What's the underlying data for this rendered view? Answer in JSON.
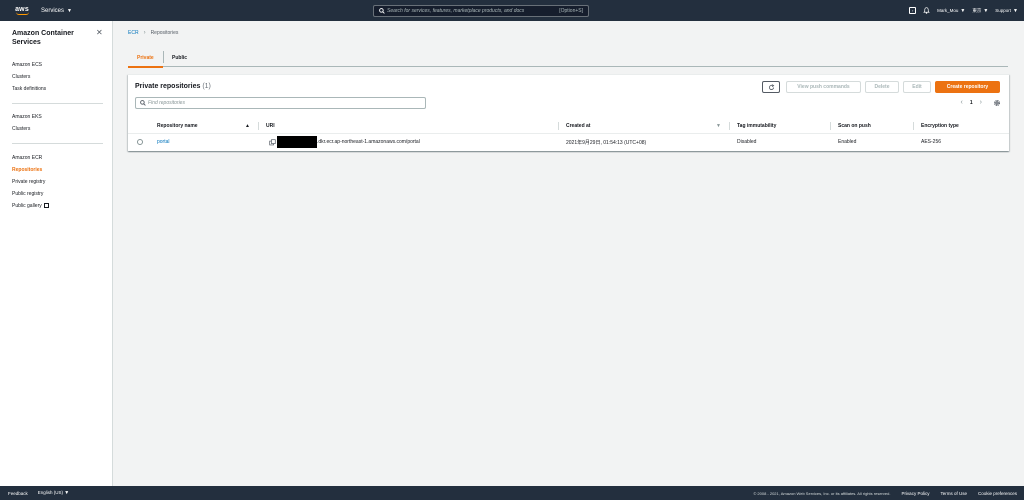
{
  "topnav": {
    "logo": "aws",
    "services_label": "Services",
    "search_placeholder": "Search for services, features, marketplace products, and docs",
    "search_shortcut": "[Option+S]",
    "user": "Mark_Mou",
    "region": "東京",
    "support": "Support"
  },
  "sidebar": {
    "title": "Amazon Container Services",
    "groups": [
      {
        "items": [
          {
            "label": "Amazon ECS"
          },
          {
            "label": "Clusters"
          },
          {
            "label": "Task definitions"
          }
        ]
      },
      {
        "items": [
          {
            "label": "Amazon EKS"
          },
          {
            "label": "Clusters"
          }
        ]
      },
      {
        "items": [
          {
            "label": "Amazon ECR"
          },
          {
            "label": "Repositories",
            "active": true
          },
          {
            "label": "Private registry"
          },
          {
            "label": "Public registry"
          },
          {
            "label": "Public gallery"
          }
        ]
      }
    ]
  },
  "breadcrumb": {
    "root": "ECR",
    "current": "Repositories"
  },
  "tabs": [
    {
      "label": "Private",
      "active": true
    },
    {
      "label": "Public"
    }
  ],
  "panel": {
    "title": "Private repositories",
    "count": "(1)",
    "buttons": {
      "view_push": "View push commands",
      "delete": "Delete",
      "edit": "Edit",
      "create": "Create repository"
    },
    "find_placeholder": "Find repositories",
    "page": "1"
  },
  "table": {
    "columns": [
      "Repository name",
      "URI",
      "Created at",
      "Tag immutability",
      "Scan on push",
      "Encryption type"
    ],
    "rows": [
      {
        "name": "portal",
        "uri": ".dkr.ecr.ap-northeast-1.amazonaws.com/portal",
        "created_at": "2021年9月29日, 01:54:13 (UTC+08)",
        "tag_immutability": "Disabled",
        "scan_on_push": "Enabled",
        "encryption": "AES-256"
      }
    ]
  },
  "footer": {
    "feedback": "Feedback",
    "language": "English (US)",
    "copyright": "© 2008 - 2021, Amazon Web Services, Inc. or its affiliates. All rights reserved.",
    "privacy": "Privacy Policy",
    "terms": "Terms of Use",
    "cookies": "Cookie preferences"
  },
  "colors": {
    "accent": "#ec7211",
    "link": "#0073bb",
    "nav_bg": "#232f3e"
  }
}
